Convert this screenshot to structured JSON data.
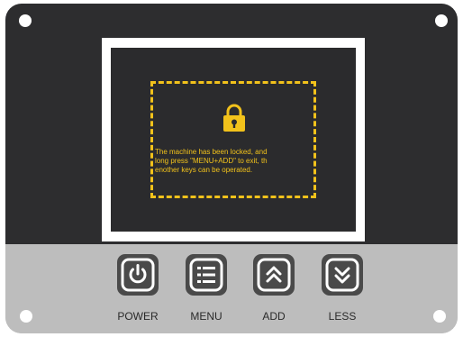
{
  "screen": {
    "message_lines": [
      "The machine has been locked, and",
      "long press \"MENU+ADD\" to exit, th",
      "enother keys can be operated."
    ],
    "icon": "lock-icon"
  },
  "buttons": [
    {
      "label": "POWER",
      "icon": "power-icon"
    },
    {
      "label": "MENU",
      "icon": "menu-icon"
    },
    {
      "label": "ADD",
      "icon": "chevron-double-up-icon"
    },
    {
      "label": "LESS",
      "icon": "chevron-double-down-icon"
    }
  ],
  "colors": {
    "panel_dark": "#2d2d2f",
    "panel_light": "#bdbdbd",
    "accent_yellow": "#f2c21b",
    "button_dark": "#4a4a4a"
  }
}
